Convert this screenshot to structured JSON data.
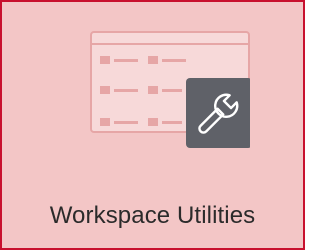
{
  "tile": {
    "label": "Workspace Utilities",
    "icon": "wrench-icon",
    "illustration": "workspace-list-illustration"
  },
  "colors": {
    "tile_background": "#f3c6c6",
    "tile_border": "#c8102e",
    "illustration_stroke": "#e6a6a6",
    "illustration_fill": "#f7d9d9",
    "badge_background": "#5f6168",
    "badge_icon": "#ffffff",
    "label_text": "#2b2b2b"
  }
}
